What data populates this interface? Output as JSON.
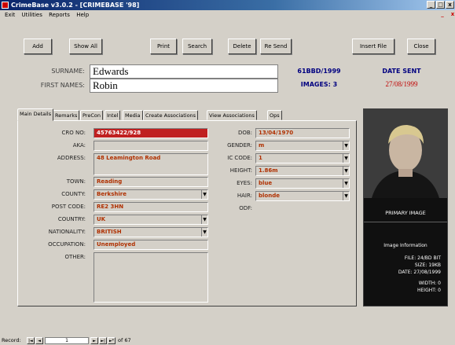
{
  "window": {
    "title": "CrimeBase v3.0.2 - [CRIMEBASE '98]",
    "controls": [
      "_",
      "□",
      "x"
    ]
  },
  "menu": {
    "items": [
      "Exit",
      "Utilities",
      "Reports",
      "Help"
    ]
  },
  "toolbar": {
    "add": "Add",
    "show_all": "Show All",
    "print": "Print",
    "search": "Search",
    "delete": "Delete",
    "re_send": "Re Send",
    "insert_file": "Insert File",
    "close": "Close"
  },
  "header": {
    "surname_label": "SURNAME:",
    "surname": "Edwards",
    "first_names_label": "FIRST NAMES:",
    "first_names": "Robin",
    "ref": "61BBD/1999",
    "images": "IMAGES: 3",
    "date_sent_label": "DATE SENT",
    "date_sent": "27/08/1999"
  },
  "tabs": [
    "Main Details",
    "Remarks",
    "PreCon",
    "Intel",
    "Media",
    "Create Associations",
    "View Associations",
    "Ops"
  ],
  "main_details": {
    "left": [
      {
        "label": "CRO NO:",
        "value": "45763422/928"
      },
      {
        "label": "AKA:",
        "value": ""
      },
      {
        "label": "ADDRESS:",
        "value": "48 Leamington Road"
      },
      {
        "label": "TOWN:",
        "value": "Reading"
      },
      {
        "label": "COUNTY:",
        "value": "Berkshire"
      },
      {
        "label": "POST CODE:",
        "value": "RE2 3HN"
      },
      {
        "label": "COUNTRY:",
        "value": "UK"
      },
      {
        "label": "NATIONALITY:",
        "value": "BRITISH"
      },
      {
        "label": "OCCUPATION:",
        "value": "Unemployed"
      },
      {
        "label": "OTHER:",
        "value": ""
      }
    ],
    "right": [
      {
        "label": "DOB:",
        "value": "13/04/1970"
      },
      {
        "label": "GENDER:",
        "value": "m"
      },
      {
        "label": "IC CODE:",
        "value": "1"
      },
      {
        "label": "HEIGHT:",
        "value": "1.86m"
      },
      {
        "label": "EYES:",
        "value": "blue"
      },
      {
        "label": "HAIR:",
        "value": "blonde"
      },
      {
        "label": "ODF:",
        "value": ""
      }
    ]
  },
  "image_panel": {
    "caption": "PRIMARY IMAGE",
    "info_title": "Image Information",
    "file": "FILE: 24/BD BIT",
    "size": "SIZE: 19KB",
    "date": "DATE: 27/08/1999",
    "width": "WIDTH: 0",
    "height": "HEIGHT: 0"
  },
  "record_nav": {
    "label": "Record:",
    "current": "1",
    "total": "of 67"
  },
  "colors": {
    "value_text": "#b03000",
    "highlight": "#c02020",
    "titlebar": "#0a246a",
    "date_red": "#c00000"
  }
}
